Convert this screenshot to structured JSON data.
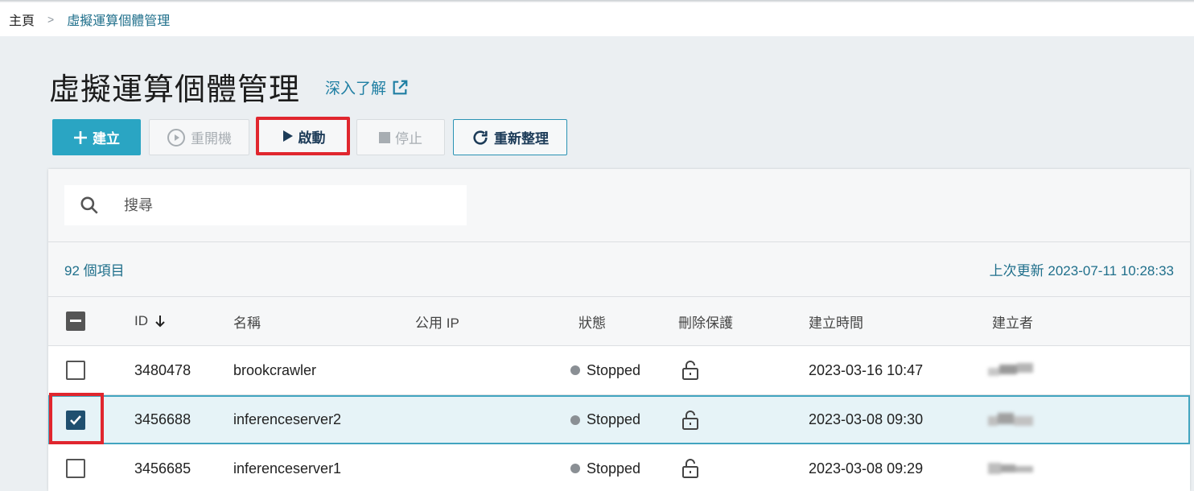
{
  "breadcrumb": {
    "home": "主頁",
    "separator": ">",
    "current": "虛擬運算個體管理"
  },
  "page": {
    "title": "虛擬運算個體管理",
    "learn_more": "深入了解"
  },
  "toolbar": {
    "create": "建立",
    "reboot": "重開機",
    "start": "啟動",
    "stop": "停止",
    "refresh": "重新整理"
  },
  "search": {
    "placeholder": "搜尋"
  },
  "summary": {
    "count": "92 個項目",
    "last_updated": "上次更新 2023-07-11 10:28:33"
  },
  "table": {
    "headers": {
      "id": "ID",
      "name": "名稱",
      "public_ip": "公用 IP",
      "status": "狀態",
      "delete_protection": "刪除保護",
      "created_time": "建立時間",
      "creator": "建立者"
    },
    "sort_icon": "arrow-down-icon",
    "rows": [
      {
        "id": "3480478",
        "name": "brookcrawler",
        "public_ip": "",
        "status": "Stopped",
        "created_time": "2023-03-16 10:47",
        "selected": false
      },
      {
        "id": "3456688",
        "name": "inferenceserver2",
        "public_ip": "",
        "status": "Stopped",
        "created_time": "2023-03-08 09:30",
        "selected": true
      },
      {
        "id": "3456685",
        "name": "inferenceserver1",
        "public_ip": "",
        "status": "Stopped",
        "created_time": "2023-03-08 09:29",
        "selected": false
      }
    ]
  },
  "colors": {
    "primary": "#2aa5c3",
    "link": "#1f7fa3",
    "highlight": "#e0262e",
    "selected_row": "#e6f3f7"
  }
}
